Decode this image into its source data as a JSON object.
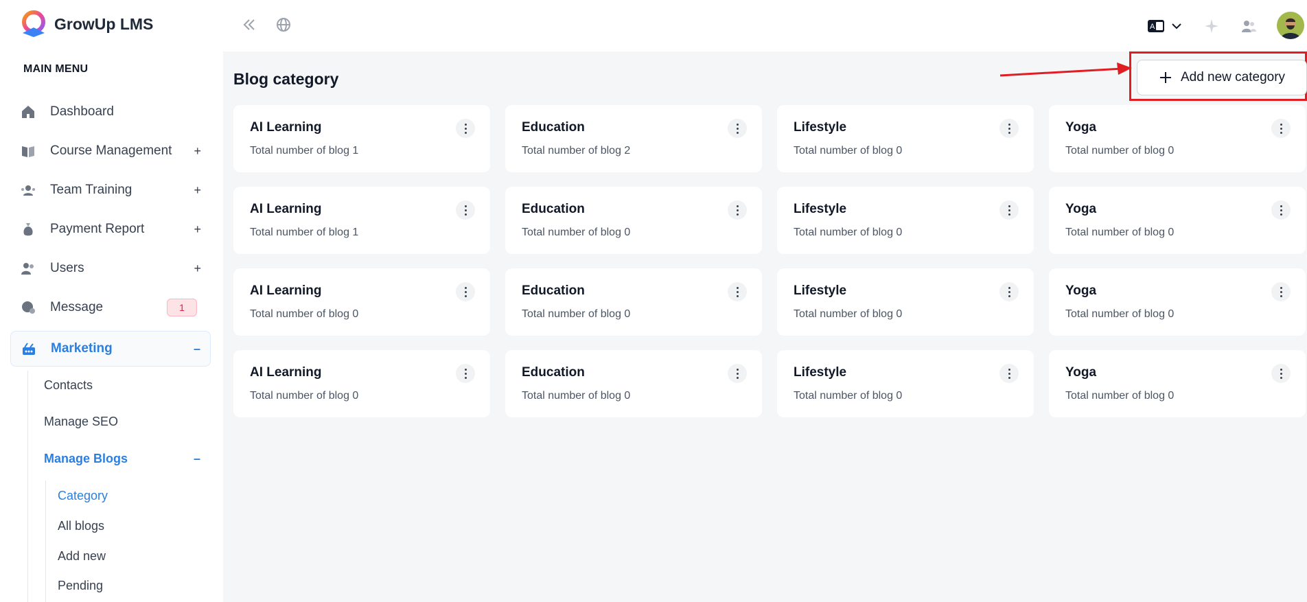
{
  "app": {
    "name": "GrowUp LMS"
  },
  "sidebar": {
    "heading": "MAIN MENU",
    "items": [
      {
        "label": "Dashboard",
        "toggle": ""
      },
      {
        "label": "Course Management",
        "toggle": "+"
      },
      {
        "label": "Team Training",
        "toggle": "+"
      },
      {
        "label": "Payment Report",
        "toggle": "+"
      },
      {
        "label": "Users",
        "toggle": "+"
      },
      {
        "label": "Message",
        "badge": "1"
      },
      {
        "label": "Marketing",
        "toggle": "–"
      }
    ],
    "marketing_sub": [
      {
        "label": "Contacts"
      },
      {
        "label": "Manage SEO"
      },
      {
        "label": "Manage Blogs",
        "toggle": "–"
      }
    ],
    "blogs_sub": [
      {
        "label": "Category"
      },
      {
        "label": "All blogs"
      },
      {
        "label": "Add new"
      },
      {
        "label": "Pending"
      }
    ]
  },
  "page": {
    "title": "Blog category",
    "add_button": "Add new category"
  },
  "count_prefix": "Total number of blog",
  "categories": [
    {
      "name": "AI Learning",
      "count": "Total number of blog 1"
    },
    {
      "name": "Education",
      "count": "Total number of blog 2"
    },
    {
      "name": "Lifestyle",
      "count": "Total number of blog 0"
    },
    {
      "name": "Yoga",
      "count": "Total number of blog 0"
    },
    {
      "name": "AI Learning",
      "count": "Total number of blog 1"
    },
    {
      "name": "Education",
      "count": "Total number of blog 0"
    },
    {
      "name": "Lifestyle",
      "count": "Total number of blog 0"
    },
    {
      "name": "Yoga",
      "count": "Total number of blog 0"
    },
    {
      "name": "AI Learning",
      "count": "Total number of blog 0"
    },
    {
      "name": "Education",
      "count": "Total number of blog 0"
    },
    {
      "name": "Lifestyle",
      "count": "Total number of blog 0"
    },
    {
      "name": "Yoga",
      "count": "Total number of blog 0"
    },
    {
      "name": "AI Learning",
      "count": "Total number of blog 0"
    },
    {
      "name": "Education",
      "count": "Total number of blog 0"
    },
    {
      "name": "Lifestyle",
      "count": "Total number of blog 0"
    },
    {
      "name": "Yoga",
      "count": "Total number of blog 0"
    }
  ],
  "colors": {
    "accent": "#2b7fe0",
    "highlight": "#e11d24",
    "background": "#f5f6f8"
  }
}
